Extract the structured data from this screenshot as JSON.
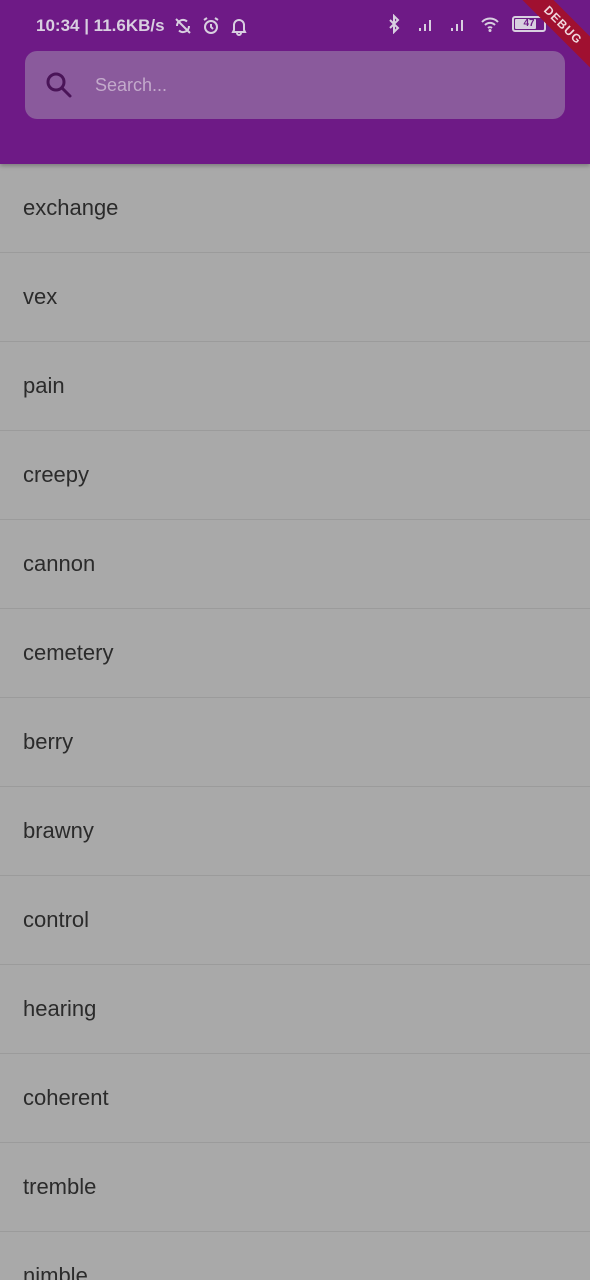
{
  "status_bar": {
    "time_and_speed": "10:34 | 11.6KB/s",
    "battery_level": "47"
  },
  "debug_banner": "DEBUG",
  "search": {
    "placeholder": "Search...",
    "value": ""
  },
  "list": {
    "items": [
      "exchange",
      "vex",
      "pain",
      "creepy",
      "cannon",
      "cemetery",
      "berry",
      "brawny",
      "control",
      "hearing",
      "coherent",
      "tremble",
      "nimble"
    ]
  }
}
